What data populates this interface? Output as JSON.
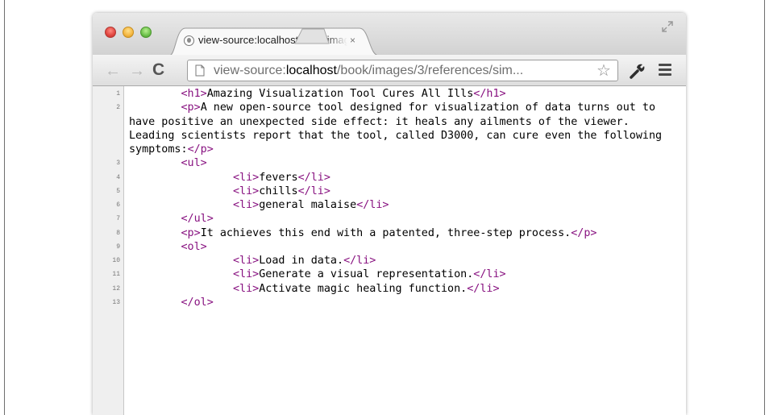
{
  "browser": {
    "tab_title": "view-source:localhost/book/images/3/references/sim",
    "tab_close": "×",
    "url_prefix": "view-source:",
    "url_host": "localhost",
    "url_path": "/book/images/3/references/sim...",
    "colors": {
      "tag": "#881280",
      "text": "#000000"
    }
  },
  "source": {
    "lines": [
      {
        "n": "1",
        "html": "        <span class=\"tag\">&lt;h1&gt;</span>Amazing Visualization Tool Cures All Ills<span class=\"tag\">&lt;/h1&gt;</span>"
      },
      {
        "n": "2",
        "html": "        <span class=\"tag\">&lt;p&gt;</span>A new open-source tool designed for visualization of data turns out to have positive an unexpected side effect: it heals any ailments of the viewer. Leading scientists report that the tool, called D3000, can cure even the following symptoms:<span class=\"tag\">&lt;/p&gt;</span>"
      },
      {
        "n": "3",
        "html": "        <span class=\"tag\">&lt;ul&gt;</span>"
      },
      {
        "n": "4",
        "html": "                <span class=\"tag\">&lt;li&gt;</span>fevers<span class=\"tag\">&lt;/li&gt;</span>"
      },
      {
        "n": "5",
        "html": "                <span class=\"tag\">&lt;li&gt;</span>chills<span class=\"tag\">&lt;/li&gt;</span>"
      },
      {
        "n": "6",
        "html": "                <span class=\"tag\">&lt;li&gt;</span>general malaise<span class=\"tag\">&lt;/li&gt;</span>"
      },
      {
        "n": "7",
        "html": "        <span class=\"tag\">&lt;/ul&gt;</span>"
      },
      {
        "n": "8",
        "html": "        <span class=\"tag\">&lt;p&gt;</span>It achieves this end with a patented, three-step process.<span class=\"tag\">&lt;/p&gt;</span>"
      },
      {
        "n": "9",
        "html": "        <span class=\"tag\">&lt;ol&gt;</span>"
      },
      {
        "n": "10",
        "html": "                <span class=\"tag\">&lt;li&gt;</span>Load in data.<span class=\"tag\">&lt;/li&gt;</span>"
      },
      {
        "n": "11",
        "html": "                <span class=\"tag\">&lt;li&gt;</span>Generate a visual representation.<span class=\"tag\">&lt;/li&gt;</span>"
      },
      {
        "n": "12",
        "html": "                <span class=\"tag\">&lt;li&gt;</span>Activate magic healing function.<span class=\"tag\">&lt;/li&gt;</span>"
      },
      {
        "n": "13",
        "html": "        <span class=\"tag\">&lt;/ol&gt;</span>"
      }
    ]
  }
}
